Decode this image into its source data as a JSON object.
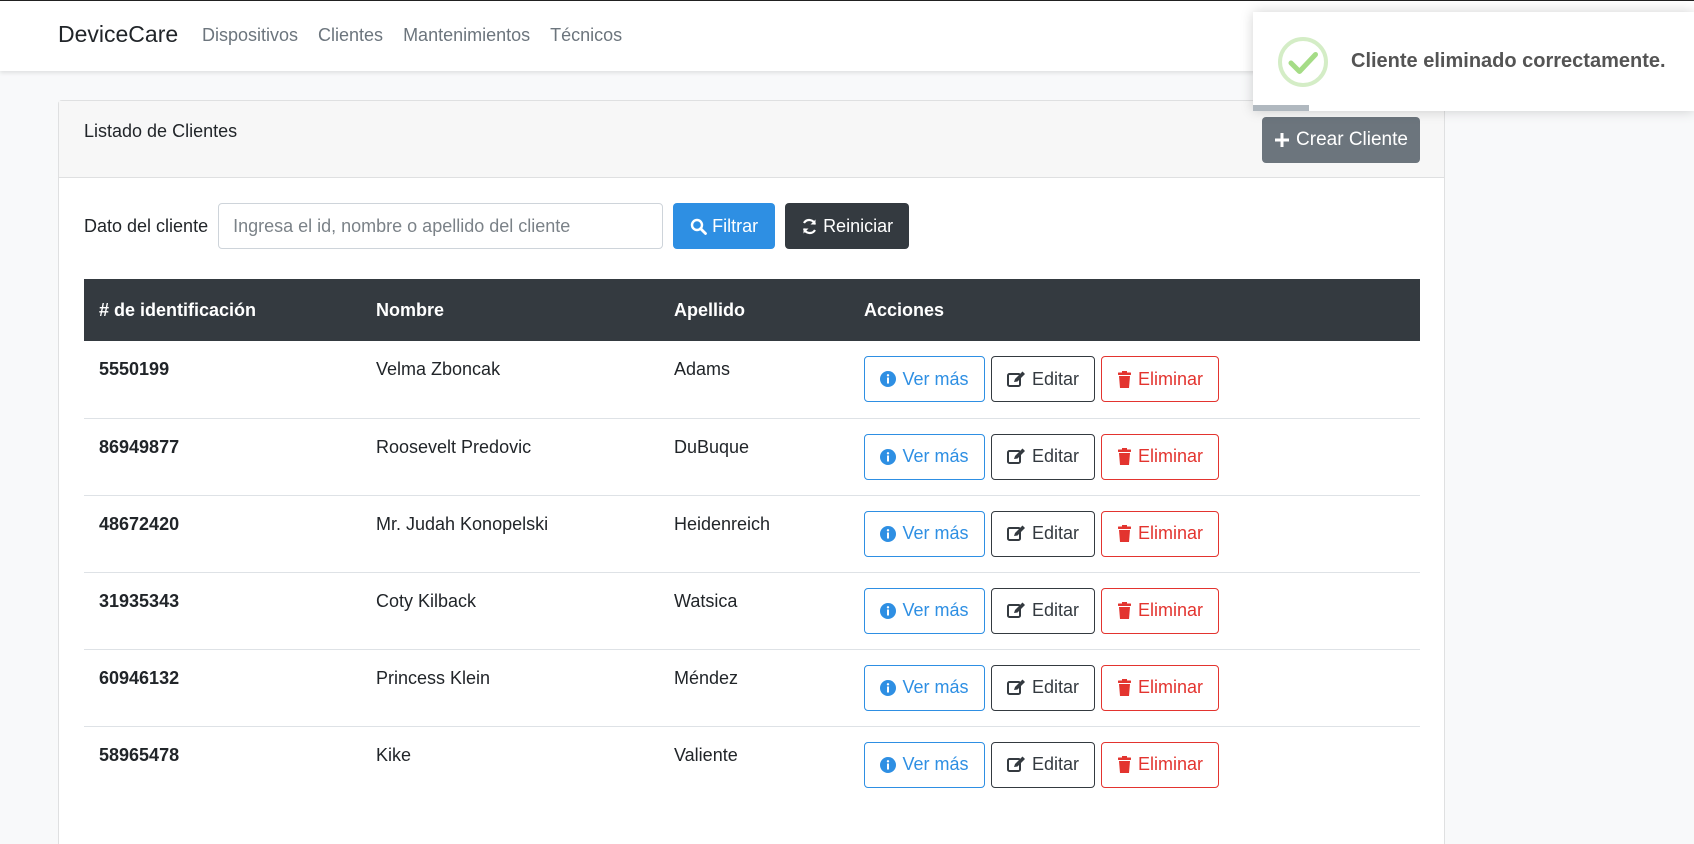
{
  "navbar": {
    "brand": "DeviceCare",
    "links": [
      "Dispositivos",
      "Clientes",
      "Mantenimientos",
      "Técnicos"
    ]
  },
  "card": {
    "title": "Listado de Clientes",
    "create_button": "Crear Cliente"
  },
  "filter": {
    "label": "Dato del cliente",
    "placeholder": "Ingresa el id, nombre o apellido del cliente",
    "value": "",
    "filter_button": "Filtrar",
    "reset_button": "Reiniciar"
  },
  "table": {
    "headers": [
      "# de identificación",
      "Nombre",
      "Apellido",
      "Acciones"
    ],
    "rows": [
      {
        "id": "5550199",
        "nombre": "Velma Zboncak",
        "apellido": "Adams"
      },
      {
        "id": "86949877",
        "nombre": "Roosevelt Predovic",
        "apellido": "DuBuque"
      },
      {
        "id": "48672420",
        "nombre": "Mr. Judah Konopelski",
        "apellido": "Heidenreich"
      },
      {
        "id": "31935343",
        "nombre": "Coty Kilback",
        "apellido": "Watsica"
      },
      {
        "id": "60946132",
        "nombre": "Princess Klein",
        "apellido": "Méndez"
      },
      {
        "id": "58965478",
        "nombre": "Kike",
        "apellido": "Valiente"
      }
    ],
    "actions": {
      "view": "Ver más",
      "edit": "Editar",
      "delete": "Eliminar"
    }
  },
  "toast": {
    "message": "Cliente eliminado correctamente.",
    "icon": "success-check-icon"
  },
  "colors": {
    "primary": "#2e8fe3",
    "dark": "#343a40",
    "secondary": "#6c757d",
    "danger": "#e3342f",
    "success": "#a5dc86"
  }
}
